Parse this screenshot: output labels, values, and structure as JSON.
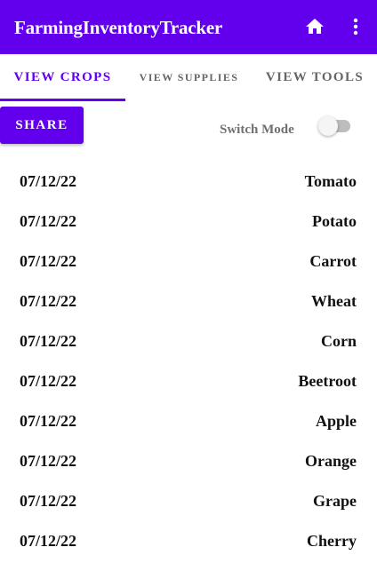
{
  "app": {
    "title": "FarmingInventoryTracker",
    "accent_color": "#6200ee",
    "actions": [
      {
        "icon": "home-icon"
      },
      {
        "icon": "more-vert-icon"
      }
    ]
  },
  "tabs": [
    {
      "label": "VIEW CROPS",
      "selected": true
    },
    {
      "label": "VIEW SUPPLIES",
      "selected": false
    },
    {
      "label": "VIEW TOOLS",
      "selected": false
    }
  ],
  "controls": {
    "share_label": "SHARE",
    "switch_label": "Switch Mode",
    "switch_on": false
  },
  "crops": [
    {
      "date": "07/12/22",
      "name": "Tomato"
    },
    {
      "date": "07/12/22",
      "name": "Potato"
    },
    {
      "date": "07/12/22",
      "name": "Carrot"
    },
    {
      "date": "07/12/22",
      "name": "Wheat"
    },
    {
      "date": "07/12/22",
      "name": "Corn"
    },
    {
      "date": "07/12/22",
      "name": "Beetroot"
    },
    {
      "date": "07/12/22",
      "name": "Apple"
    },
    {
      "date": "07/12/22",
      "name": "Orange"
    },
    {
      "date": "07/12/22",
      "name": "Grape"
    },
    {
      "date": "07/12/22",
      "name": "Cherry"
    }
  ]
}
